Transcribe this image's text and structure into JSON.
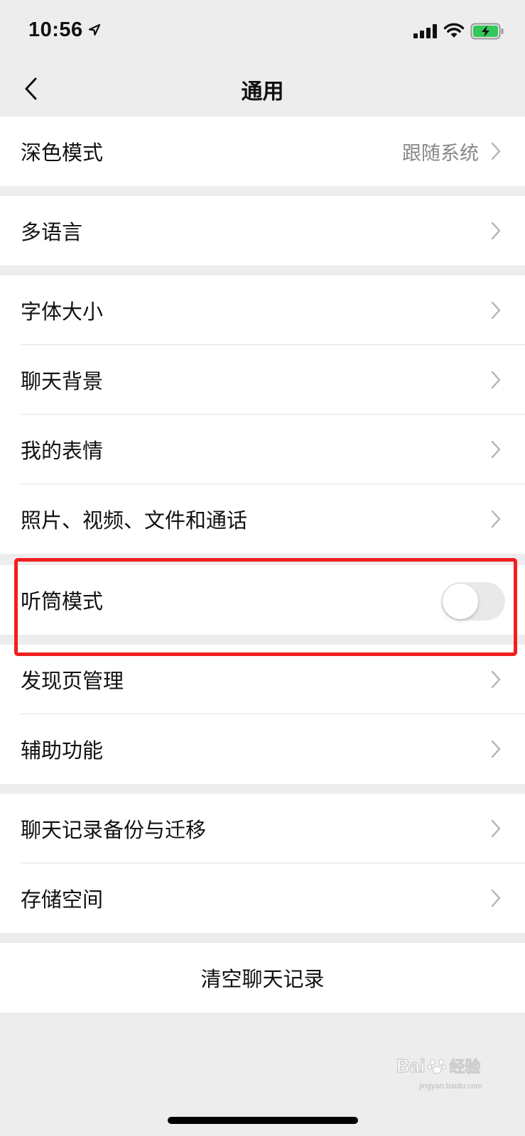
{
  "status_bar": {
    "time": "10:56",
    "icons": [
      "location-arrow-icon",
      "signal-icon",
      "wifi-icon",
      "battery-charging-icon"
    ]
  },
  "nav": {
    "title": "通用",
    "back_icon": "chevron-left-icon"
  },
  "groups": [
    {
      "items": [
        {
          "label": "深色模式",
          "value": "跟随系统"
        }
      ]
    },
    {
      "items": [
        {
          "label": "多语言"
        }
      ]
    },
    {
      "items": [
        {
          "label": "字体大小"
        },
        {
          "label": "聊天背景"
        },
        {
          "label": "我的表情"
        },
        {
          "label": "照片、视频、文件和通话"
        }
      ]
    },
    {
      "items": [
        {
          "label": "听筒模式",
          "toggle": false
        }
      ]
    },
    {
      "items": [
        {
          "label": "发现页管理"
        },
        {
          "label": "辅助功能"
        }
      ]
    },
    {
      "items": [
        {
          "label": "聊天记录备份与迁移"
        },
        {
          "label": "存储空间"
        }
      ]
    }
  ],
  "clear_button": {
    "label": "清空聊天记录"
  },
  "watermark": {
    "brand": "Bai",
    "brand_cn": "经验",
    "url": "jingyan.baidu.com"
  },
  "colors": {
    "background": "#ededed",
    "highlight": "#f11f1f",
    "toggle_off": "#e9e9ea"
  }
}
